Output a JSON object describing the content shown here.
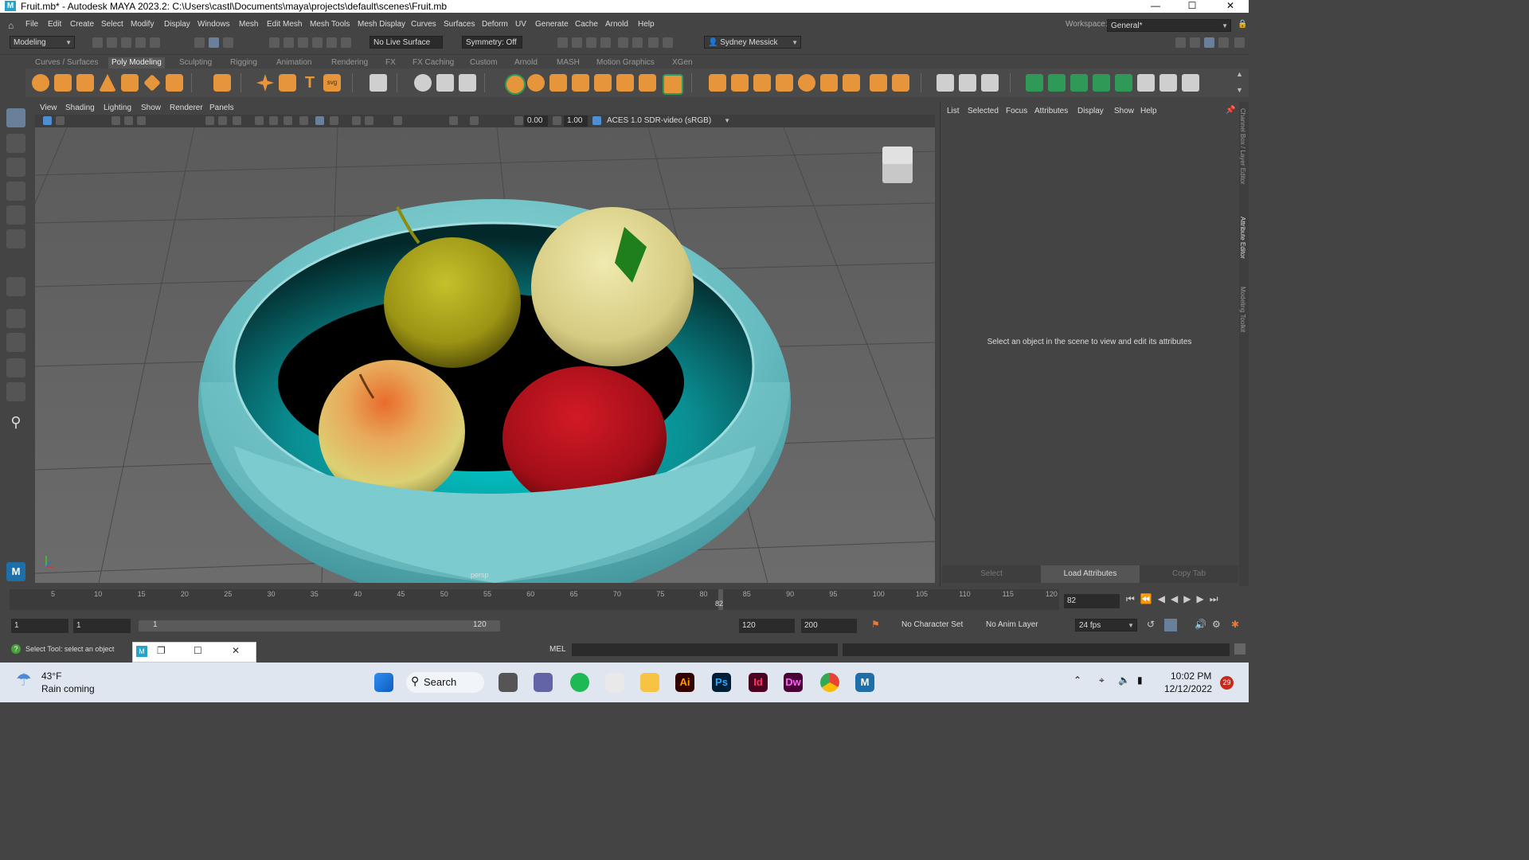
{
  "window": {
    "title": "Fruit.mb* - Autodesk MAYA 2023.2: C:\\Users\\castl\\Documents\\maya\\projects\\default\\scenes\\Fruit.mb",
    "logo": "M"
  },
  "menubar": {
    "items": [
      "File",
      "Edit",
      "Create",
      "Select",
      "Modify",
      "Display",
      "Windows",
      "Mesh",
      "Edit Mesh",
      "Mesh Tools",
      "Mesh Display",
      "Curves",
      "Surfaces",
      "Deform",
      "UV",
      "Generate",
      "Cache",
      "Arnold",
      "Help"
    ],
    "workspace_label": "Workspace:",
    "workspace_value": "General*"
  },
  "statusline": {
    "mode": "Modeling",
    "live_surface": "No Live Surface",
    "symmetry": "Symmetry: Off",
    "user": "Sydney Messick"
  },
  "shelf": {
    "tabs": [
      "Curves / Surfaces",
      "Poly Modeling",
      "Sculpting",
      "Rigging",
      "Animation",
      "Rendering",
      "FX",
      "FX Caching",
      "Custom",
      "Arnold",
      "MASH",
      "Motion Graphics",
      "XGen"
    ],
    "active_tab": "Poly Modeling"
  },
  "viewport": {
    "menus": [
      "View",
      "Shading",
      "Lighting",
      "Show",
      "Renderer",
      "Panels"
    ],
    "exposure": "0.00",
    "gamma": "1.00",
    "color_space": "ACES 1.0 SDR-video (sRGB)",
    "camera_label": "persp"
  },
  "attribute_editor": {
    "tabs": [
      "List",
      "Selected",
      "Focus",
      "Attributes",
      "Display",
      "Show",
      "Help"
    ],
    "message": "Select an object in the scene to view and edit its attributes",
    "buttons": [
      "Select",
      "Load Attributes",
      "Copy Tab"
    ],
    "side_labels": [
      "Channel Box / Layer Editor",
      "Attribute Editor",
      "Modeling Toolkit"
    ]
  },
  "timeline": {
    "ticks": [
      "5",
      "10",
      "15",
      "20",
      "25",
      "30",
      "35",
      "40",
      "45",
      "50",
      "55",
      "60",
      "65",
      "70",
      "75",
      "80",
      "85",
      "90",
      "95",
      "100",
      "105",
      "110",
      "115",
      "120"
    ],
    "current_frame": "82",
    "current_frame_field": "82"
  },
  "range": {
    "start": "1",
    "playback_start": "1",
    "slider_start": "1",
    "slider_end": "120",
    "playback_end": "120",
    "end": "200",
    "character_set": "No Character Set",
    "anim_layer": "No Anim Layer",
    "fps": "24 fps"
  },
  "commandline": {
    "help_text": "Select Tool: select an object",
    "language": "MEL"
  },
  "taskbar": {
    "weather_temp": "43°F",
    "weather_text": "Rain coming",
    "search": "Search",
    "time": "10:02 PM",
    "date": "12/12/2022",
    "notifications": "29",
    "apps": [
      {
        "name": "Ai",
        "color": "#330000",
        "fg": "#ff9a00"
      },
      {
        "name": "Ps",
        "color": "#001e36",
        "fg": "#31a8ff"
      },
      {
        "name": "Id",
        "color": "#49021f",
        "fg": "#ff3366"
      },
      {
        "name": "Dw",
        "color": "#470137",
        "fg": "#ff61f6"
      }
    ]
  }
}
